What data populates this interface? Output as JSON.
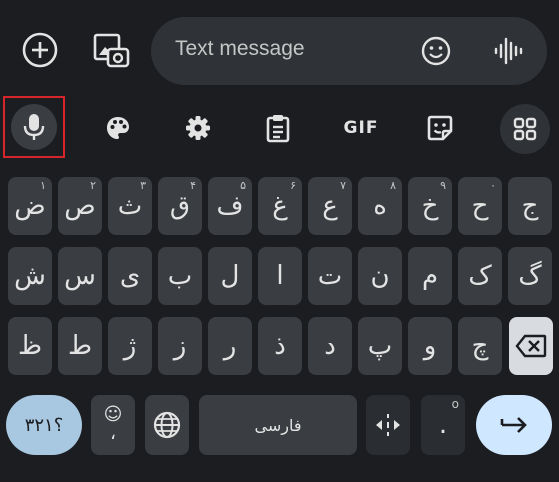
{
  "compose": {
    "placeholder": "Text message",
    "add_icon": "plus-circle-icon",
    "gallery_icon": "gallery-icon",
    "emoji_icon": "emoji-icon",
    "voice_icon": "voice-wave-icon"
  },
  "toolbar": {
    "gif_label": "GIF",
    "items": [
      "mic-icon",
      "palette-icon",
      "gear-icon",
      "clipboard-icon",
      "gif-icon",
      "sticker-icon",
      "grid-icon"
    ]
  },
  "rows": [
    [
      {
        "label": "ض",
        "hint": "۱"
      },
      {
        "label": "ص",
        "hint": "۲"
      },
      {
        "label": "ث",
        "hint": "۳"
      },
      {
        "label": "ق",
        "hint": "۴"
      },
      {
        "label": "ف",
        "hint": "۵"
      },
      {
        "label": "غ",
        "hint": "۶"
      },
      {
        "label": "ع",
        "hint": "۷"
      },
      {
        "label": "ه",
        "hint": "۸"
      },
      {
        "label": "خ",
        "hint": "۹"
      },
      {
        "label": "ح",
        "hint": "۰"
      },
      {
        "label": "ج",
        "hint": ""
      }
    ],
    [
      {
        "label": "ش"
      },
      {
        "label": "س"
      },
      {
        "label": "ی"
      },
      {
        "label": "ب"
      },
      {
        "label": "ل"
      },
      {
        "label": "ا"
      },
      {
        "label": "ت"
      },
      {
        "label": "ن"
      },
      {
        "label": "م"
      },
      {
        "label": "ک"
      },
      {
        "label": "گ"
      }
    ],
    [
      {
        "label": "ظ"
      },
      {
        "label": "ط"
      },
      {
        "label": "ژ"
      },
      {
        "label": "ز"
      },
      {
        "label": "ر"
      },
      {
        "label": "ذ"
      },
      {
        "label": "د"
      },
      {
        "label": "پ"
      },
      {
        "label": "و"
      },
      {
        "label": "چ"
      }
    ]
  ],
  "bottom": {
    "symbols_label": "؟۳۲۱",
    "emoji_comma_top": "☺",
    "emoji_comma_bottom": "،",
    "globe_icon": "globe-icon",
    "space_label": "فارسی",
    "cursor_icon": "cursor-move-icon",
    "period_label": ".",
    "period_hint": "o"
  }
}
